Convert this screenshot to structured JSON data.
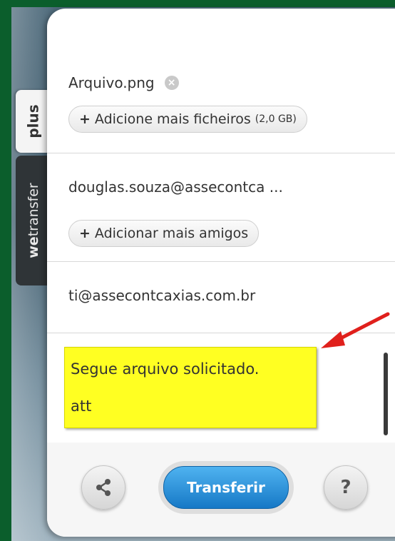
{
  "tabs": {
    "plus": "plus",
    "wetransfer_bold": "we",
    "wetransfer_rest": "transfer"
  },
  "files": {
    "items": [
      {
        "name": "Arquivo.png"
      }
    ],
    "add_label": "Adicione mais ficheiros",
    "size_note": "(2,0 GB)"
  },
  "friends": {
    "emails": [
      "douglas.souza@assecontca ..."
    ],
    "add_label": "Adicionar mais amigos"
  },
  "sender": {
    "email": "ti@assecontcaxias.com.br"
  },
  "message": {
    "line1": "Segue arquivo solicitado.",
    "line2": "att",
    "highlight_color": "#ffff22"
  },
  "footer": {
    "transfer_label": "Transferir",
    "help_label": "?"
  },
  "colors": {
    "accent": "#1678c6",
    "frame": "#0b5e2c",
    "annotation_arrow": "#e0201c"
  },
  "icons": {
    "remove": "remove-icon",
    "share": "share-icon",
    "help": "help-icon",
    "plus": "plus-icon"
  }
}
